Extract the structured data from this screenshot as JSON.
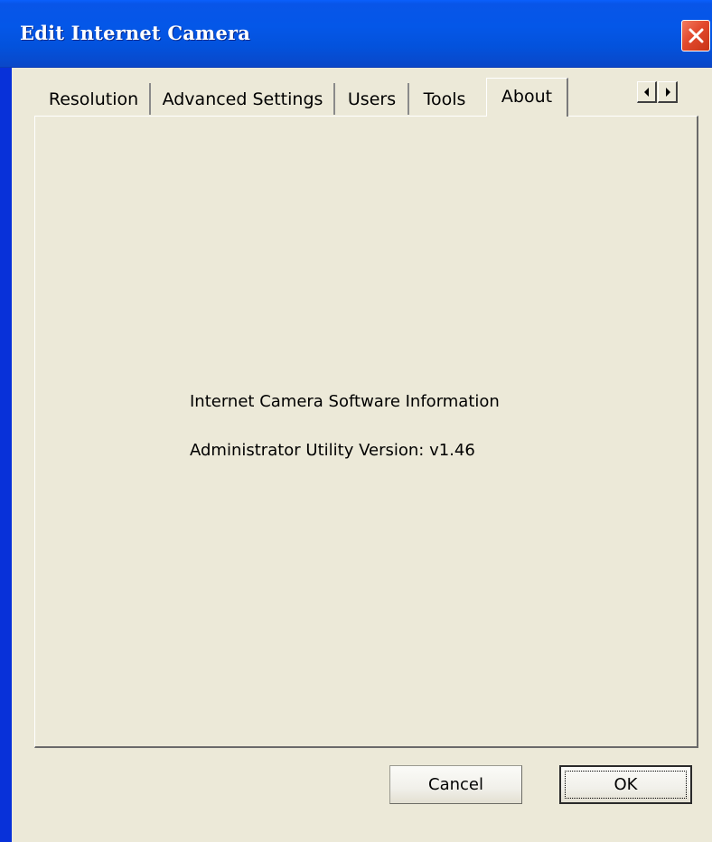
{
  "window": {
    "title": "Edit Internet Camera",
    "close_icon": "close-icon",
    "close_color": "#e2492d"
  },
  "tabs": [
    {
      "label": "Resolution",
      "active": false
    },
    {
      "label": "Advanced Settings",
      "active": false
    },
    {
      "label": "Users",
      "active": false
    },
    {
      "label": "Tools",
      "active": false
    },
    {
      "label": "About",
      "active": true
    }
  ],
  "tab_scroll": {
    "left_icon": "arrow-left-icon",
    "right_icon": "arrow-right-icon"
  },
  "about": {
    "heading": "Internet Camera Software Information",
    "version": "Administrator Utility Version: v1.46"
  },
  "buttons": {
    "cancel": "Cancel",
    "ok": "OK"
  },
  "colors": {
    "titlebar": "#0457e8",
    "client_bg": "#ece9d8",
    "close_button": "#e2492d"
  }
}
